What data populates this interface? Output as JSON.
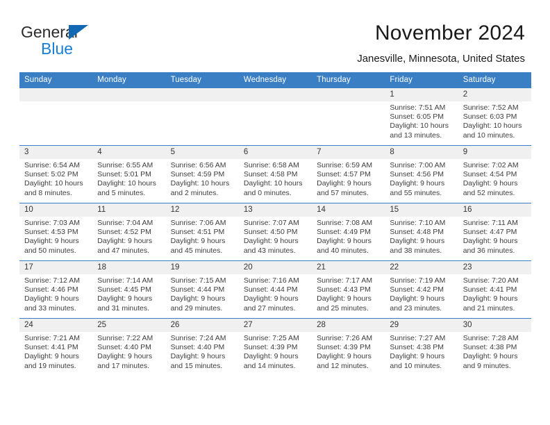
{
  "brand": {
    "line1": "General",
    "line2": "Blue",
    "triangle_color": "#1268b3",
    "line2_color": "#1a7fd4"
  },
  "header": {
    "title": "November 2024",
    "location": "Janesville, Minnesota, United States"
  },
  "theme": {
    "header_blue": "#3a7fc4",
    "daynum_gray": "#f0f0f0",
    "text_color": "#3d3d3d"
  },
  "weekdays": [
    "Sunday",
    "Monday",
    "Tuesday",
    "Wednesday",
    "Thursday",
    "Friday",
    "Saturday"
  ],
  "weeks": [
    [
      {
        "day": "",
        "empty": true
      },
      {
        "day": "",
        "empty": true
      },
      {
        "day": "",
        "empty": true
      },
      {
        "day": "",
        "empty": true
      },
      {
        "day": "",
        "empty": true
      },
      {
        "day": "1",
        "sunrise": "Sunrise: 7:51 AM",
        "sunset": "Sunset: 6:05 PM",
        "daylight": "Daylight: 10 hours and 13 minutes."
      },
      {
        "day": "2",
        "sunrise": "Sunrise: 7:52 AM",
        "sunset": "Sunset: 6:03 PM",
        "daylight": "Daylight: 10 hours and 10 minutes."
      }
    ],
    [
      {
        "day": "3",
        "sunrise": "Sunrise: 6:54 AM",
        "sunset": "Sunset: 5:02 PM",
        "daylight": "Daylight: 10 hours and 8 minutes."
      },
      {
        "day": "4",
        "sunrise": "Sunrise: 6:55 AM",
        "sunset": "Sunset: 5:01 PM",
        "daylight": "Daylight: 10 hours and 5 minutes."
      },
      {
        "day": "5",
        "sunrise": "Sunrise: 6:56 AM",
        "sunset": "Sunset: 4:59 PM",
        "daylight": "Daylight: 10 hours and 2 minutes."
      },
      {
        "day": "6",
        "sunrise": "Sunrise: 6:58 AM",
        "sunset": "Sunset: 4:58 PM",
        "daylight": "Daylight: 10 hours and 0 minutes."
      },
      {
        "day": "7",
        "sunrise": "Sunrise: 6:59 AM",
        "sunset": "Sunset: 4:57 PM",
        "daylight": "Daylight: 9 hours and 57 minutes."
      },
      {
        "day": "8",
        "sunrise": "Sunrise: 7:00 AM",
        "sunset": "Sunset: 4:56 PM",
        "daylight": "Daylight: 9 hours and 55 minutes."
      },
      {
        "day": "9",
        "sunrise": "Sunrise: 7:02 AM",
        "sunset": "Sunset: 4:54 PM",
        "daylight": "Daylight: 9 hours and 52 minutes."
      }
    ],
    [
      {
        "day": "10",
        "sunrise": "Sunrise: 7:03 AM",
        "sunset": "Sunset: 4:53 PM",
        "daylight": "Daylight: 9 hours and 50 minutes."
      },
      {
        "day": "11",
        "sunrise": "Sunrise: 7:04 AM",
        "sunset": "Sunset: 4:52 PM",
        "daylight": "Daylight: 9 hours and 47 minutes."
      },
      {
        "day": "12",
        "sunrise": "Sunrise: 7:06 AM",
        "sunset": "Sunset: 4:51 PM",
        "daylight": "Daylight: 9 hours and 45 minutes."
      },
      {
        "day": "13",
        "sunrise": "Sunrise: 7:07 AM",
        "sunset": "Sunset: 4:50 PM",
        "daylight": "Daylight: 9 hours and 43 minutes."
      },
      {
        "day": "14",
        "sunrise": "Sunrise: 7:08 AM",
        "sunset": "Sunset: 4:49 PM",
        "daylight": "Daylight: 9 hours and 40 minutes."
      },
      {
        "day": "15",
        "sunrise": "Sunrise: 7:10 AM",
        "sunset": "Sunset: 4:48 PM",
        "daylight": "Daylight: 9 hours and 38 minutes."
      },
      {
        "day": "16",
        "sunrise": "Sunrise: 7:11 AM",
        "sunset": "Sunset: 4:47 PM",
        "daylight": "Daylight: 9 hours and 36 minutes."
      }
    ],
    [
      {
        "day": "17",
        "sunrise": "Sunrise: 7:12 AM",
        "sunset": "Sunset: 4:46 PM",
        "daylight": "Daylight: 9 hours and 33 minutes."
      },
      {
        "day": "18",
        "sunrise": "Sunrise: 7:14 AM",
        "sunset": "Sunset: 4:45 PM",
        "daylight": "Daylight: 9 hours and 31 minutes."
      },
      {
        "day": "19",
        "sunrise": "Sunrise: 7:15 AM",
        "sunset": "Sunset: 4:44 PM",
        "daylight": "Daylight: 9 hours and 29 minutes."
      },
      {
        "day": "20",
        "sunrise": "Sunrise: 7:16 AM",
        "sunset": "Sunset: 4:44 PM",
        "daylight": "Daylight: 9 hours and 27 minutes."
      },
      {
        "day": "21",
        "sunrise": "Sunrise: 7:17 AM",
        "sunset": "Sunset: 4:43 PM",
        "daylight": "Daylight: 9 hours and 25 minutes."
      },
      {
        "day": "22",
        "sunrise": "Sunrise: 7:19 AM",
        "sunset": "Sunset: 4:42 PM",
        "daylight": "Daylight: 9 hours and 23 minutes."
      },
      {
        "day": "23",
        "sunrise": "Sunrise: 7:20 AM",
        "sunset": "Sunset: 4:41 PM",
        "daylight": "Daylight: 9 hours and 21 minutes."
      }
    ],
    [
      {
        "day": "24",
        "sunrise": "Sunrise: 7:21 AM",
        "sunset": "Sunset: 4:41 PM",
        "daylight": "Daylight: 9 hours and 19 minutes."
      },
      {
        "day": "25",
        "sunrise": "Sunrise: 7:22 AM",
        "sunset": "Sunset: 4:40 PM",
        "daylight": "Daylight: 9 hours and 17 minutes."
      },
      {
        "day": "26",
        "sunrise": "Sunrise: 7:24 AM",
        "sunset": "Sunset: 4:40 PM",
        "daylight": "Daylight: 9 hours and 15 minutes."
      },
      {
        "day": "27",
        "sunrise": "Sunrise: 7:25 AM",
        "sunset": "Sunset: 4:39 PM",
        "daylight": "Daylight: 9 hours and 14 minutes."
      },
      {
        "day": "28",
        "sunrise": "Sunrise: 7:26 AM",
        "sunset": "Sunset: 4:39 PM",
        "daylight": "Daylight: 9 hours and 12 minutes."
      },
      {
        "day": "29",
        "sunrise": "Sunrise: 7:27 AM",
        "sunset": "Sunset: 4:38 PM",
        "daylight": "Daylight: 9 hours and 10 minutes."
      },
      {
        "day": "30",
        "sunrise": "Sunrise: 7:28 AM",
        "sunset": "Sunset: 4:38 PM",
        "daylight": "Daylight: 9 hours and 9 minutes."
      }
    ]
  ]
}
